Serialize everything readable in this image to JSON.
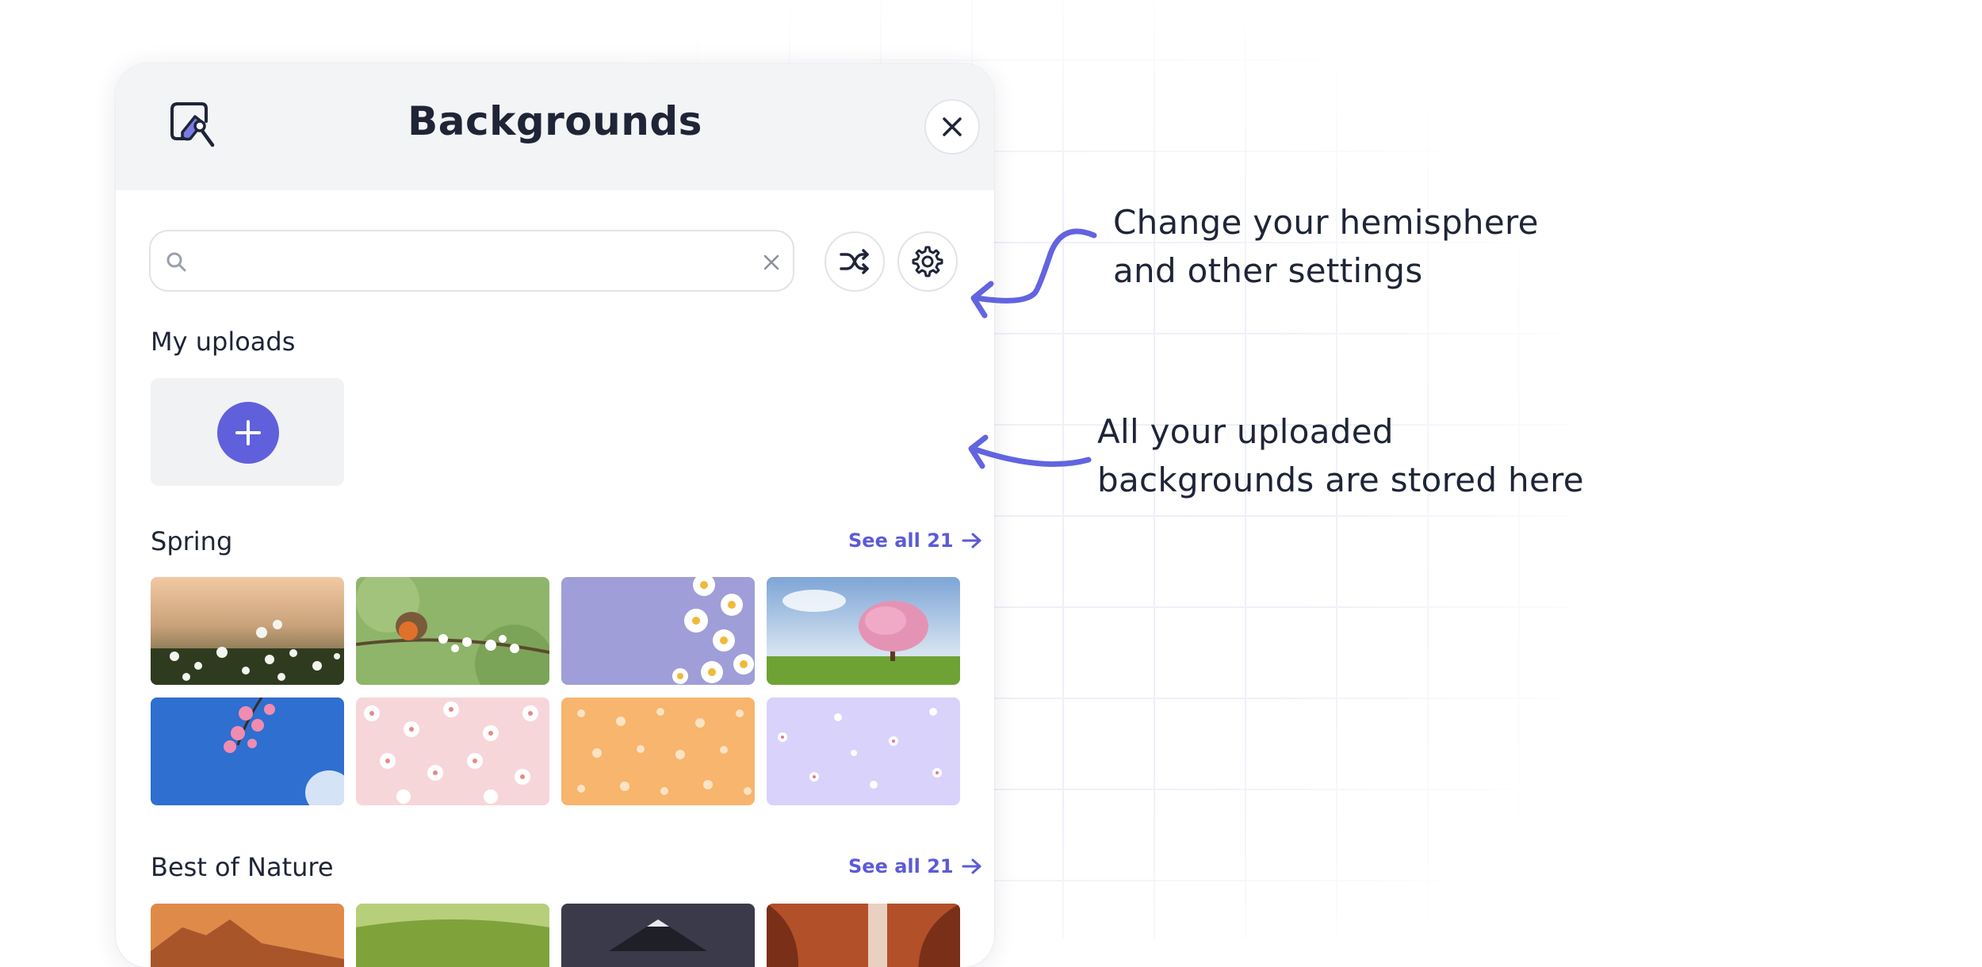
{
  "panel": {
    "title": "Backgrounds",
    "header_icon": "background-brush-icon",
    "close_icon": "close-icon"
  },
  "search": {
    "value": "",
    "placeholder": "",
    "search_icon": "search-icon",
    "clear_icon": "clear-icon"
  },
  "toolbar": {
    "shuffle_icon": "shuffle-icon",
    "settings_icon": "gear-icon"
  },
  "uploads": {
    "title": "My uploads",
    "add_icon": "plus-icon"
  },
  "sections": [
    {
      "title": "Spring",
      "see_all": "See all 21",
      "thumbnails": [
        "daisies-field",
        "robin-on-blossom-branch",
        "daisies-on-purple",
        "pink-blossom-tree",
        "cherry-blossom-sky",
        "pink-daisy-pattern",
        "orange-butterfly-pattern",
        "lavender-flower-pattern"
      ]
    },
    {
      "title": "Best of Nature",
      "see_all": "See all 21",
      "thumbnails": [
        "desert-mountain",
        "green-hills",
        "volcano-sunset",
        "canyon-waterfall"
      ]
    }
  ],
  "annotations": {
    "settings": [
      "Change your hemisphere",
      "and other settings"
    ],
    "uploads": [
      "All your uploaded",
      "backgrounds are stored here"
    ]
  },
  "colors": {
    "accent": "#5b5bd6",
    "plus_button": "#6060dd",
    "header_bg": "#f3f4f6",
    "text": "#1f2537"
  }
}
